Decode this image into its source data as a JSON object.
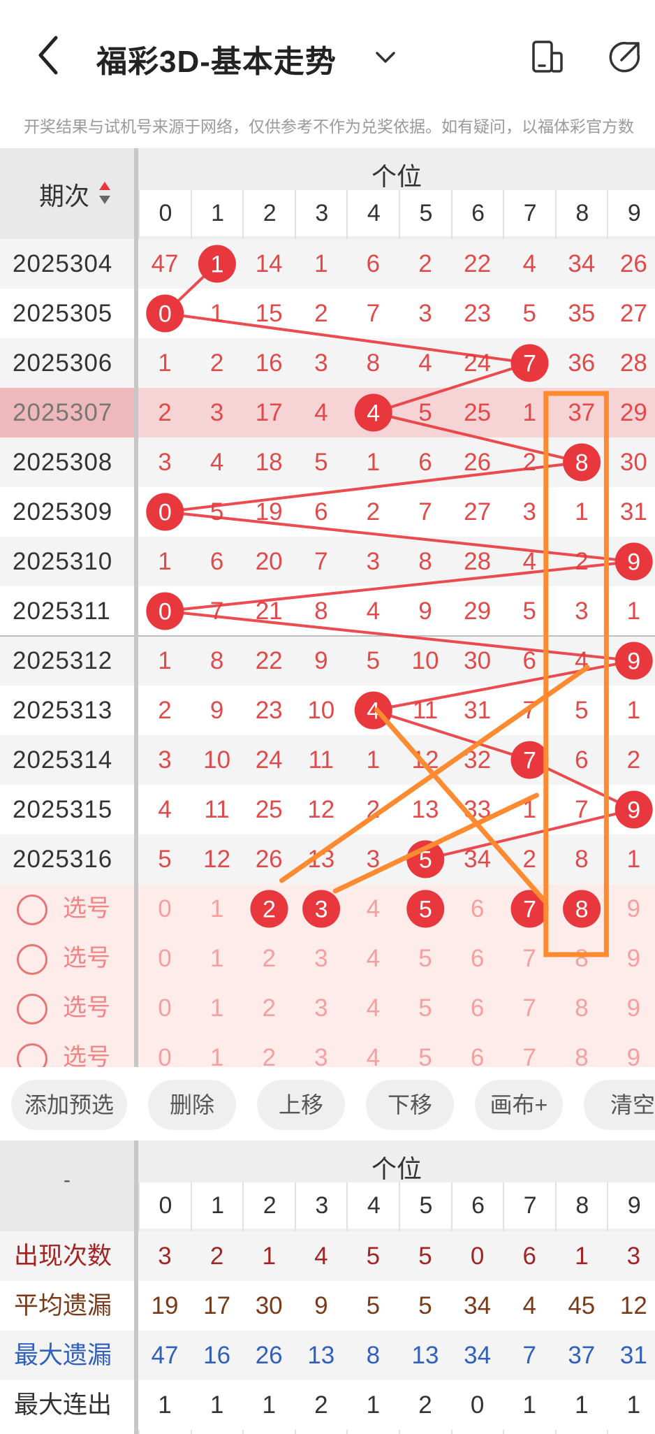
{
  "header": {
    "title": "福彩3D-基本走势",
    "back_icon": "chevron-left-icon",
    "dropdown_icon": "chevron-down-icon",
    "phone_icon": "phone-toggle-icon",
    "share_icon": "share-icon"
  },
  "notice": "开奖结果与试机号来源于网络，仅供参考不作为兑奖依据。如有疑问，以福体彩官方数",
  "trend": {
    "period_header": "期次",
    "group_header": "个位",
    "digits": [
      "0",
      "1",
      "2",
      "3",
      "4",
      "5",
      "6",
      "7",
      "8",
      "9"
    ],
    "rows": [
      {
        "period": "2025304",
        "hit": 1,
        "values": [
          "47",
          "1",
          "14",
          "1",
          "6",
          "2",
          "22",
          "4",
          "34",
          "26"
        ]
      },
      {
        "period": "2025305",
        "hit": 0,
        "values": [
          "0",
          "1",
          "15",
          "2",
          "7",
          "3",
          "23",
          "5",
          "35",
          "27"
        ]
      },
      {
        "period": "2025306",
        "hit": 7,
        "values": [
          "1",
          "2",
          "16",
          "3",
          "8",
          "4",
          "24",
          "7",
          "36",
          "28"
        ]
      },
      {
        "period": "2025307",
        "hit": 4,
        "values": [
          "2",
          "3",
          "17",
          "4",
          "4",
          "5",
          "25",
          "1",
          "37",
          "29"
        ]
      },
      {
        "period": "2025308",
        "hit": 8,
        "values": [
          "3",
          "4",
          "18",
          "5",
          "1",
          "6",
          "26",
          "2",
          "8",
          "30"
        ]
      },
      {
        "period": "2025309",
        "hit": 0,
        "values": [
          "0",
          "5",
          "19",
          "6",
          "2",
          "7",
          "27",
          "3",
          "1",
          "31"
        ]
      },
      {
        "period": "2025310",
        "hit": 9,
        "values": [
          "1",
          "6",
          "20",
          "7",
          "3",
          "8",
          "28",
          "4",
          "2",
          "9"
        ]
      },
      {
        "period": "2025311",
        "hit": 0,
        "values": [
          "0",
          "7",
          "21",
          "8",
          "4",
          "9",
          "29",
          "5",
          "3",
          "1"
        ]
      },
      {
        "period": "2025312",
        "hit": 9,
        "values": [
          "1",
          "8",
          "22",
          "9",
          "5",
          "10",
          "30",
          "6",
          "4",
          "9"
        ]
      },
      {
        "period": "2025313",
        "hit": 4,
        "values": [
          "2",
          "9",
          "23",
          "10",
          "4",
          "11",
          "31",
          "7",
          "5",
          "1"
        ]
      },
      {
        "period": "2025314",
        "hit": 7,
        "values": [
          "3",
          "10",
          "24",
          "11",
          "1",
          "12",
          "32",
          "7",
          "6",
          "2"
        ]
      },
      {
        "period": "2025315",
        "hit": 9,
        "values": [
          "4",
          "11",
          "25",
          "12",
          "2",
          "13",
          "33",
          "1",
          "7",
          "9"
        ]
      },
      {
        "period": "2025316",
        "hit": 5,
        "values": [
          "5",
          "12",
          "26",
          "13",
          "3",
          "5",
          "34",
          "2",
          "8",
          "1"
        ]
      }
    ],
    "pick_rows": [
      {
        "label": "选号",
        "selected": [
          2,
          3,
          5,
          7,
          8
        ],
        "values": [
          "0",
          "1",
          "2",
          "3",
          "4",
          "5",
          "6",
          "7",
          "8",
          "9"
        ]
      },
      {
        "label": "选号",
        "selected": [],
        "values": [
          "0",
          "1",
          "2",
          "3",
          "4",
          "5",
          "6",
          "7",
          "8",
          "9"
        ]
      },
      {
        "label": "选号",
        "selected": [],
        "values": [
          "0",
          "1",
          "2",
          "3",
          "4",
          "5",
          "6",
          "7",
          "8",
          "9"
        ]
      },
      {
        "label": "选号",
        "selected": [],
        "values": [
          "0",
          "1",
          "2",
          "3",
          "4",
          "5",
          "6",
          "7",
          "8",
          "9"
        ]
      }
    ]
  },
  "toolbar": {
    "buttons": [
      "添加预选",
      "删除",
      "上移",
      "下移",
      "画布+",
      "清空"
    ]
  },
  "stats": {
    "corner": "-",
    "group_header": "个位",
    "digits": [
      "0",
      "1",
      "2",
      "3",
      "4",
      "5",
      "6",
      "7",
      "8",
      "9"
    ],
    "rows": [
      {
        "label": "出现次数",
        "color": "#a32424",
        "values": [
          "3",
          "2",
          "1",
          "4",
          "5",
          "5",
          "0",
          "6",
          "1",
          "3"
        ]
      },
      {
        "label": "平均遗漏",
        "color": "#7a3a1a",
        "values": [
          "19",
          "17",
          "30",
          "9",
          "5",
          "5",
          "34",
          "4",
          "45",
          "12"
        ]
      },
      {
        "label": "最大遗漏",
        "color": "#2f5fbf",
        "values": [
          "47",
          "16",
          "26",
          "13",
          "8",
          "13",
          "34",
          "7",
          "37",
          "31"
        ]
      },
      {
        "label": "最大连出",
        "color": "#333333",
        "values": [
          "1",
          "1",
          "1",
          "2",
          "1",
          "2",
          "0",
          "1",
          "1",
          "1"
        ]
      }
    ]
  },
  "colors": {
    "hit": "#e8383d",
    "number": "#e14a4a",
    "highlight_row": "#f6d3d5",
    "pick_bg": "#fdecea",
    "orange": "#ff8a30"
  }
}
